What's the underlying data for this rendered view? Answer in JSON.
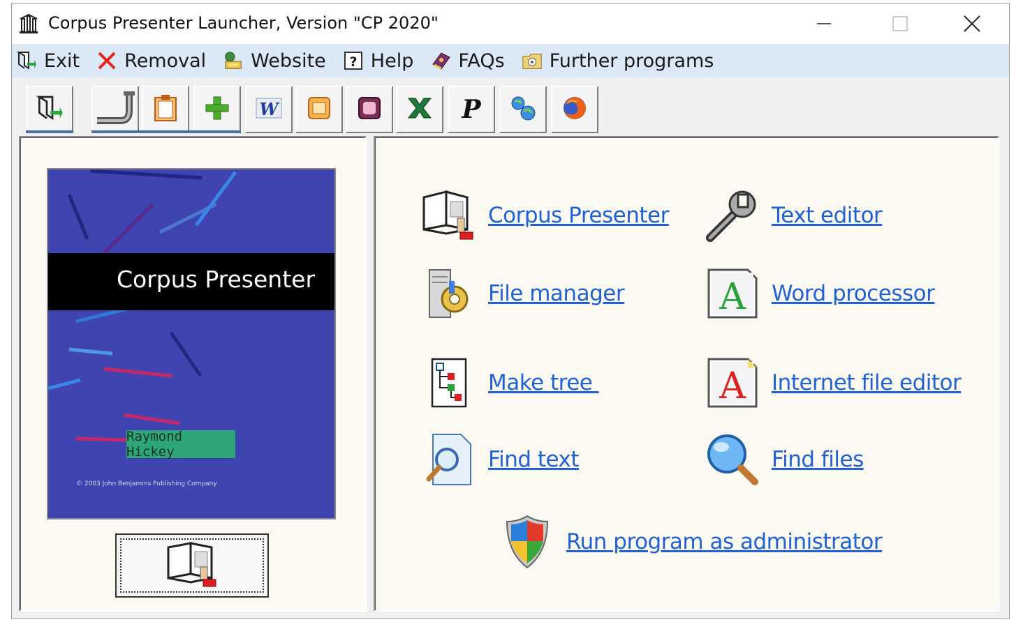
{
  "window": {
    "title": "Corpus Presenter Launcher, Version \"CP 2020\""
  },
  "menu": [
    {
      "label": "Exit",
      "icon": "exit-icon"
    },
    {
      "label": "Removal",
      "icon": "red-x-icon"
    },
    {
      "label": "Website",
      "icon": "website-icon"
    },
    {
      "label": "Help",
      "icon": "help-icon"
    },
    {
      "label": "FAQs",
      "icon": "faq-book-icon"
    },
    {
      "label": "Further programs",
      "icon": "programs-folder-icon"
    }
  ],
  "toolbar": {
    "buttons": [
      "exit-icon",
      "pipe-icon",
      "clipboard-icon",
      "green-plus-icon",
      "word-icon",
      "orange-file-icon",
      "pink-file-icon",
      "excel-icon",
      "p-letter-icon",
      "network-icon",
      "firefox-icon"
    ],
    "p_letter": "P"
  },
  "cover": {
    "title": "Corpus Presenter",
    "author": "Raymond Hickey",
    "copyright": "© 2003 John Benjamins Publishing Company"
  },
  "links": {
    "corpus_presenter": "Corpus Presenter",
    "text_editor": "Text editor",
    "file_manager": "File manager",
    "word_processor": "Word processor",
    "make_tree": "Make tree ",
    "internet_file_editor": "Internet file editor",
    "find_text": "Find text",
    "find_files": "Find files",
    "run_admin": "Run program as administrator"
  },
  "icon_letters": {
    "word_processor": "A",
    "internet_file_editor": "A",
    "word_toolbar": "W"
  },
  "colors": {
    "link": "#1f62d8",
    "menubar": "#dbe9f7",
    "cover_blue": "#3f44b0",
    "author_green": "#2fa57a"
  }
}
